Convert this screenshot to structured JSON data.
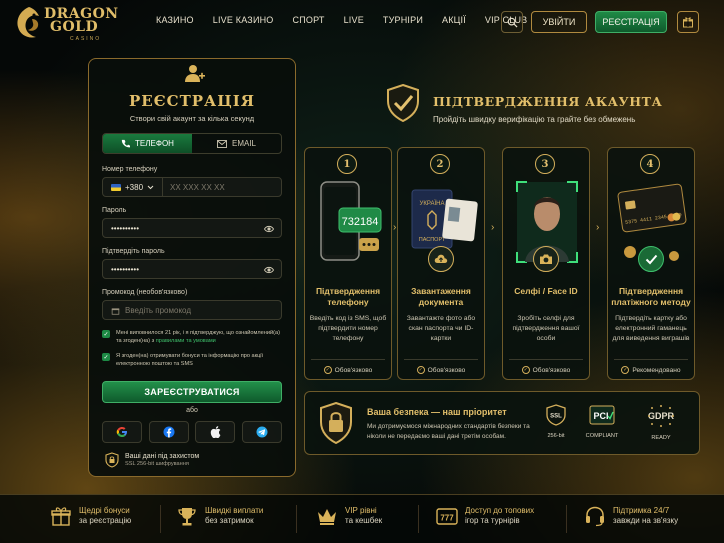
{
  "brand": {
    "logo_line1": "DRAGON",
    "logo_line2": "GOLD",
    "logo_sub": "CASINO"
  },
  "nav": {
    "items": [
      "КАЗИНО",
      "LIVE КАЗИНО",
      "СПОРТ",
      "LIVE",
      "ТУРНІРИ",
      "АКЦІЇ",
      "VIP CLUB"
    ]
  },
  "header": {
    "login_label": "УВІЙТИ",
    "register_label": "РЕЄСТРАЦІЯ"
  },
  "registration": {
    "title": "РЕЄСТРАЦІЯ",
    "subtitle": "Створи свій акаунт за кілька секунд",
    "tab_phone": "ТЕЛЕФОН",
    "tab_email": "EMAIL",
    "phone_label": "Номер телефону",
    "dial_code": "+380",
    "phone_placeholder": "XX XXX XX XX",
    "password_label": "Пароль",
    "password_value": "••••••••••",
    "confirm_label": "Підтвердіть пароль",
    "confirm_value": "••••••••••",
    "promo_label": "Промокод (необов'язково)",
    "promo_placeholder": "Введіть промокод",
    "consent1_a": "Мені виповнилося 21 рік, і я підтверджую, що ознайомлений(а) та згоден(на) з ",
    "consent1_link": "правилами та умовами",
    "consent2": "Я згоден(на) отримувати бонуси та інформацію про акції електронною поштою та SMS",
    "submit_label": "ЗАРЕЄСТРУВАТИСЯ",
    "or_label": "або",
    "secure_title": "Ваші дані під захистом",
    "secure_sub": "SSL 256-bit шифрування"
  },
  "verification": {
    "title": "ПІДТВЕРДЖЕННЯ АКАУНТА",
    "subtitle": "Пройдіть швидку верифікацію та грайте без обмежень",
    "steps": [
      {
        "num": "1",
        "title": "Підтвердження телефону",
        "desc": "Введіть код із SMS, щоб підтвердити номер телефону",
        "status": "Обов'язково",
        "sms_code": "732184"
      },
      {
        "num": "2",
        "title": "Завантаження документа",
        "desc": "Завантажте фото або скан паспорта чи ID-картки",
        "status": "Обов'язково",
        "doc_country": "УКРАЇНА",
        "doc_type": "ПАСПОРТ"
      },
      {
        "num": "3",
        "title": "Селфі / Face ID",
        "desc": "Зробіть селфі для підтвердження вашої особи",
        "status": "Обов'язково"
      },
      {
        "num": "4",
        "title": "Підтвердження платіжного методу",
        "desc": "Підтвердіть картку або електронний гаманець для виведення виграшів",
        "status": "Рекомендовано",
        "card_number": "5375 4411 2345 6789"
      }
    ]
  },
  "security": {
    "title": "Ваша безпека — наш пріоритет",
    "desc": "Ми дотримуємося міжнародних стандартів безпеки та ніколи не передаємо ваші дані третім особам.",
    "certs": [
      {
        "badge": "SSL",
        "caption": "256-bit"
      },
      {
        "badge": "PCI",
        "caption": "COMPLIANT"
      },
      {
        "badge": "GDPR",
        "caption": "READY"
      }
    ]
  },
  "features": [
    {
      "line1": "Щедрі бонуси",
      "line2": "за реєстрацію"
    },
    {
      "line1": "Швидкі виплати",
      "line2": "без затримок"
    },
    {
      "line1": "VIP рівні",
      "line2": "та кешбек"
    },
    {
      "line1": "Доступ до топових",
      "line2": "ігор та турнірів"
    },
    {
      "line1": "Підтримка 24/7",
      "line2": "завжди на зв'язку"
    }
  ]
}
